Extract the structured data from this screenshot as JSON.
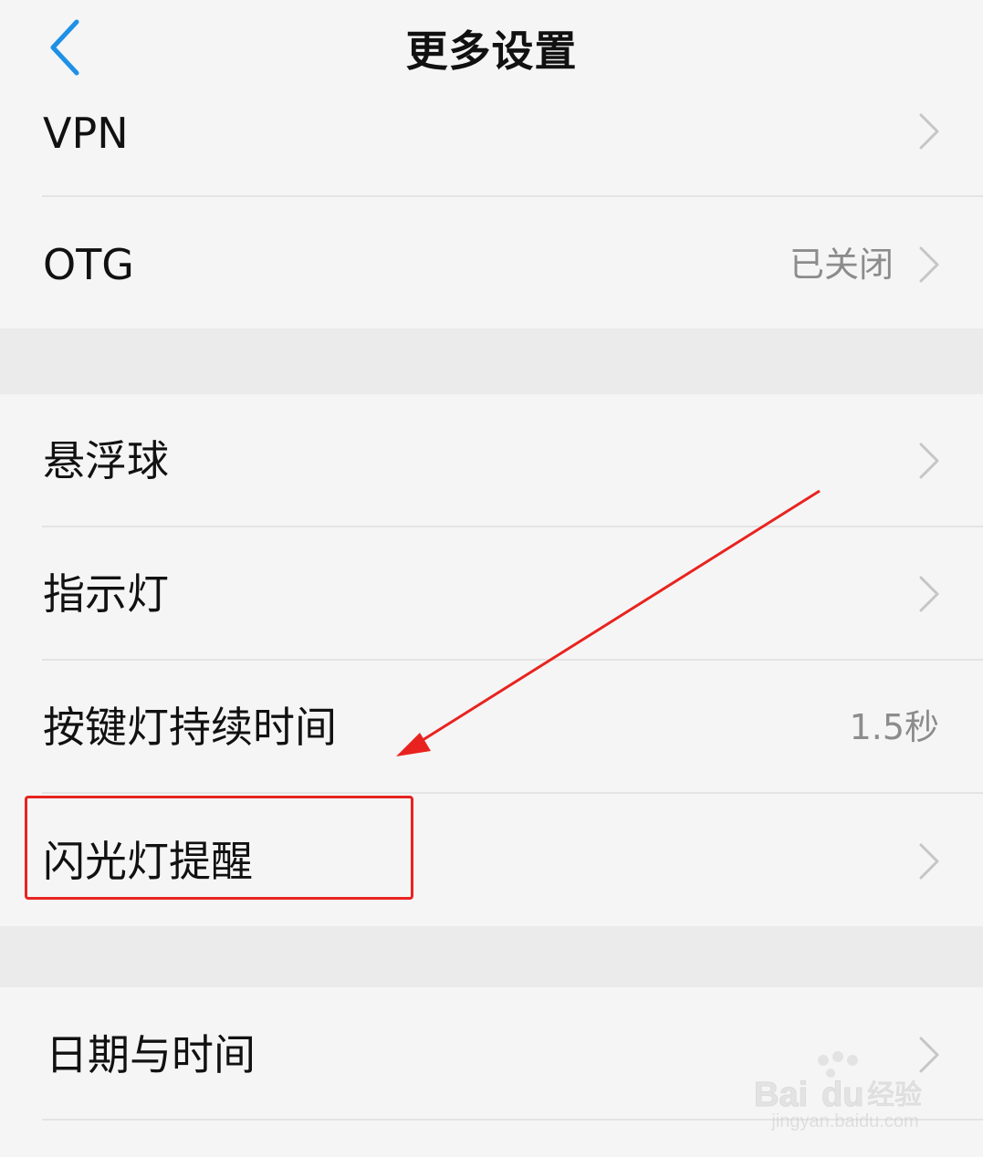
{
  "header": {
    "title": "更多设置"
  },
  "group1": {
    "items": [
      {
        "label": "VPN",
        "value": ""
      },
      {
        "label": "OTG",
        "value": "已关闭"
      }
    ]
  },
  "group2": {
    "items": [
      {
        "label": "悬浮球",
        "value": ""
      },
      {
        "label": "指示灯",
        "value": ""
      },
      {
        "label": "按键灯持续时间",
        "value": "1.5秒"
      },
      {
        "label": "闪光灯提醒",
        "value": ""
      }
    ]
  },
  "group3": {
    "items": [
      {
        "label": "日期与时间",
        "value": ""
      }
    ]
  },
  "watermark": {
    "brand": "Bai du 经验",
    "url": "jingyan.baidu.com"
  },
  "icons": {
    "back": "chevron-left-icon",
    "row_arrow": "chevron-right-icon"
  },
  "colors": {
    "accent": "#1e90e6",
    "annotation": "#e8231f",
    "background": "#f5f5f5",
    "section_gap": "#ebebeb"
  }
}
